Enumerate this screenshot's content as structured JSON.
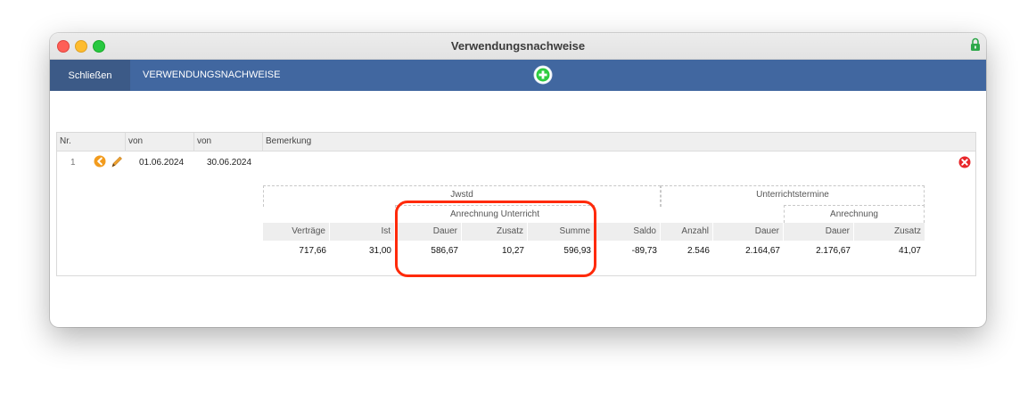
{
  "window": {
    "title": "Verwendungsnachweise"
  },
  "toolbar": {
    "close_label": "Schließen",
    "section_label": "VERWENDUNGSNACHWEISE"
  },
  "table": {
    "headers": {
      "nr": "Nr.",
      "von1": "von",
      "von2": "von",
      "bemerkung": "Bemerkung"
    },
    "row": {
      "nr": "1",
      "from": "01.06.2024",
      "to": "30.06.2024",
      "bemerkung": ""
    }
  },
  "summary": {
    "groups": {
      "jwstd": "Jwstd",
      "anrechnung_unterricht": "Anrechnung Unterricht",
      "unterrichtstermine": "Unterrichtstermine",
      "anrechnung": "Anrechnung"
    },
    "columns": [
      "Verträge",
      "Ist",
      "Dauer",
      "Zusatz",
      "Summe",
      "Saldo",
      "Anzahl",
      "Dauer",
      "Dauer",
      "Zusatz"
    ],
    "values": [
      "717,66",
      "31,00",
      "586,67",
      "10,27",
      "596,93",
      "-89,73",
      "2.546",
      "2.164,67",
      "2.176,67",
      "41,07"
    ]
  },
  "colors": {
    "toolbar": "#4167a0",
    "close_button": "#3c5a87",
    "highlight": "#ff2a0a",
    "add_icon": "#2ecc40",
    "delete_icon": "#e8262a",
    "back_icon": "#f29b1d"
  },
  "icons": {
    "add": "plus-circle-icon",
    "back": "arrow-left-circle-icon",
    "edit": "pencil-icon",
    "delete": "close-circle-icon",
    "lock": "lock-icon"
  }
}
